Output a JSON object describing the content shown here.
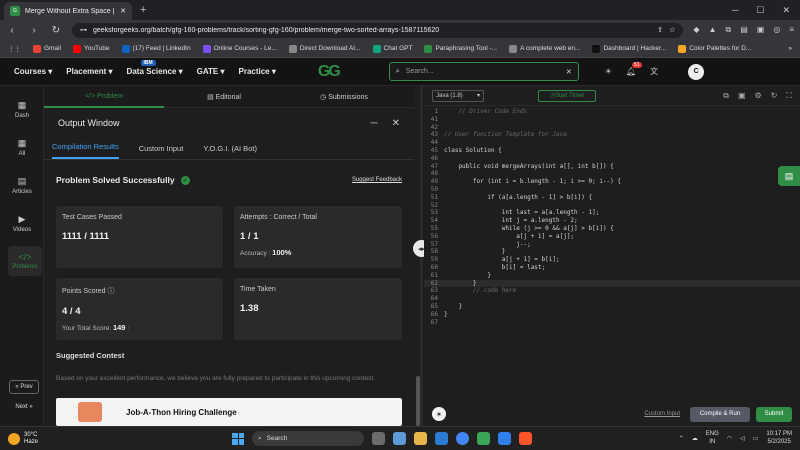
{
  "browser": {
    "tab_title": "Merge Without Extra Space | P",
    "url": "geeksforgeeks.org/batch/gfg-160-problems/track/sorting-gfg-160/problem/merge-two-sorted-arrays-1587115620"
  },
  "bookmarks": [
    {
      "label": "Gmail",
      "color": "#ea4335"
    },
    {
      "label": "YouTube",
      "color": "#ff0000"
    },
    {
      "label": "(17) Feed | LinkedIn",
      "color": "#0a66c2"
    },
    {
      "label": "Online Courses - Le...",
      "color": "#7c4dff"
    },
    {
      "label": "Direct Download AI...",
      "color": "#888888"
    },
    {
      "label": "Chat GPT",
      "color": "#10a37f"
    },
    {
      "label": "Paraphrasing Tool -...",
      "color": "#2f8d46"
    },
    {
      "label": "A complete web en...",
      "color": "#888888"
    },
    {
      "label": "Dashboard | Hacker...",
      "color": "#111111"
    },
    {
      "label": "Color Palettes for D...",
      "color": "#f6a623"
    }
  ],
  "gfg": {
    "nav": [
      "Courses",
      "Placement",
      "Data Science",
      "GATE",
      "Practice"
    ],
    "ibm_badge": "IBM",
    "logo": "GG",
    "search_placeholder": "Search...",
    "notif_count": "51",
    "avatar": "C"
  },
  "rail": {
    "dash": "Dash",
    "all": "All",
    "articles": "Articles",
    "videos": "Videos",
    "problems": "Problems",
    "prev": "« Prev",
    "next": "Next »"
  },
  "panel_tabs": [
    "Problem",
    "Editorial",
    "Submissions"
  ],
  "output": {
    "title": "Output Window",
    "tabs": [
      "Compilation Results",
      "Custom Input",
      "Y.O.G.I. (AI Bot)"
    ],
    "status": "Problem Solved Successfully",
    "feedback": "Suggest Feedback",
    "test_label": "Test Cases Passed",
    "test_value": "1111 / 1111",
    "attempts_label": "Attempts : Correct / Total",
    "attempts_value": "1 / 1",
    "accuracy_label": "Accuracy :",
    "accuracy_value": "100%",
    "points_label": "Points Scored",
    "points_value": "4 / 4",
    "score_label": "Your Total Score:",
    "score_value": "149",
    "time_label": "Time Taken",
    "time_value": "1.38",
    "suggest_title": "Suggested Contest",
    "suggest_text": "Based on your excellent performance, we believe you are fully prepared to participate in this upcoming contest.",
    "contest_title": "Job-A-Thon Hiring Challenge"
  },
  "editor": {
    "language": "Java (1.8)",
    "timer": "Start Timer",
    "custom_input": "Custom Input",
    "compile": "Compile & Run",
    "submit": "Submit",
    "lines": [
      {
        "n": "1",
        "t": "    // Driver Code Ends",
        "cm": true
      },
      {
        "n": "41",
        "t": ""
      },
      {
        "n": "42",
        "t": ""
      },
      {
        "n": "43",
        "t": "// User function Template for Java",
        "cm": true
      },
      {
        "n": "44",
        "t": ""
      },
      {
        "n": "45",
        "t": "class Solution {"
      },
      {
        "n": "46",
        "t": ""
      },
      {
        "n": "47",
        "t": "    public void mergeArrays(int a[], int b[]) {"
      },
      {
        "n": "48",
        "t": ""
      },
      {
        "n": "49",
        "t": "        for (int i = b.length - 1; i >= 0; i--) {"
      },
      {
        "n": "50",
        "t": ""
      },
      {
        "n": "51",
        "t": "            if (a[a.length - 1] > b[i]) {"
      },
      {
        "n": "52",
        "t": ""
      },
      {
        "n": "53",
        "t": "                int last = a[a.length - 1];"
      },
      {
        "n": "54",
        "t": "                int j = a.length - 2;"
      },
      {
        "n": "55",
        "t": "                while (j >= 0 && a[j] > b[i]) {"
      },
      {
        "n": "56",
        "t": "                    a[j + 1] = a[j];"
      },
      {
        "n": "57",
        "t": "                    j--;"
      },
      {
        "n": "58",
        "t": "                }"
      },
      {
        "n": "59",
        "t": "                a[j + 1] = b[i];"
      },
      {
        "n": "60",
        "t": "                b[i] = last;"
      },
      {
        "n": "61",
        "t": "            }"
      },
      {
        "n": "62",
        "t": "        }",
        "hl": true
      },
      {
        "n": "63",
        "t": "        // code here",
        "cm": true
      },
      {
        "n": "64",
        "t": ""
      },
      {
        "n": "65",
        "t": "    }"
      },
      {
        "n": "66",
        "t": "}"
      },
      {
        "n": "67",
        "t": ""
      }
    ]
  },
  "taskbar": {
    "temp": "30°C",
    "weather": "Haze",
    "search": "Search",
    "lang1": "ENG",
    "lang2": "IN",
    "time": "10:17 PM",
    "date": "5/2/2025"
  }
}
